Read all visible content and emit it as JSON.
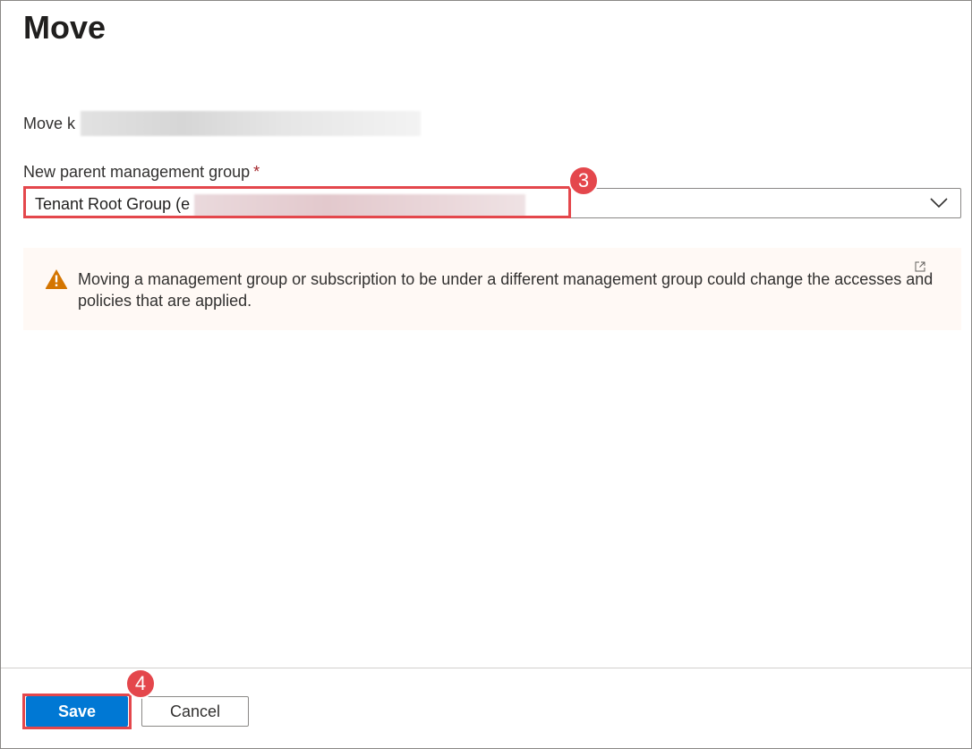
{
  "panel": {
    "title": "Move",
    "move_prefix": "Move k"
  },
  "form": {
    "parent_label": "New parent management group",
    "required_marker": "*",
    "dropdown_value": "Tenant Root Group (e"
  },
  "warning": {
    "message": "Moving a management group or subscription to be under a different management group could change the accesses and policies that are applied."
  },
  "annotations": {
    "step_dropdown": "3",
    "step_save": "4",
    "highlight_color": "#e4474c"
  },
  "footer": {
    "save_label": "Save",
    "cancel_label": "Cancel"
  },
  "colors": {
    "primary": "#0078d4",
    "warning_icon": "#d47500",
    "warning_bg": "#fff9f5",
    "required": "#a4262c"
  }
}
